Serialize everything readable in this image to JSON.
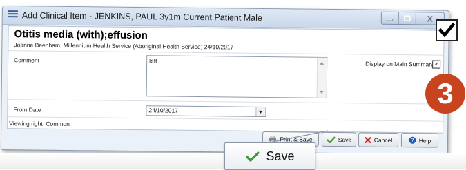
{
  "window": {
    "title": "Add Clinical Item - JENKINS, PAUL 3y1m Current Patient Male",
    "buttons": {
      "minimize_icon": "minimize-icon",
      "maximize_icon": "maximize-icon",
      "close_icon": "close-icon",
      "close_label": "X"
    }
  },
  "item": {
    "title": "Otitis media (with);effusion",
    "author_line": "Joanne Beenham, Millennium Health Service (Aboriginal Health Service) 24/10/2017"
  },
  "form": {
    "comment_label": "Comment",
    "comment_value": "left",
    "display_on_summary_label": "Display on Main Summary",
    "display_on_summary_checked": true,
    "check_mark": "✓",
    "from_date_label": "From Date",
    "from_date_value": "24/10/2017",
    "viewing_right": "Viewing right: Common"
  },
  "footer": {
    "print_save_label": "Print & Save",
    "save_label": "Save",
    "cancel_label": "Cancel",
    "help_label": "Help"
  },
  "overlay": {
    "badge_number": "3",
    "callout_save_label": "Save",
    "big_check_icon": "checkmark-icon"
  },
  "colors": {
    "accent_badge": "#c8441f",
    "save_green": "#3a9a2a",
    "cancel_red": "#c62020",
    "help_blue": "#1e5bb8",
    "window_chrome": "#c9d8ea"
  }
}
